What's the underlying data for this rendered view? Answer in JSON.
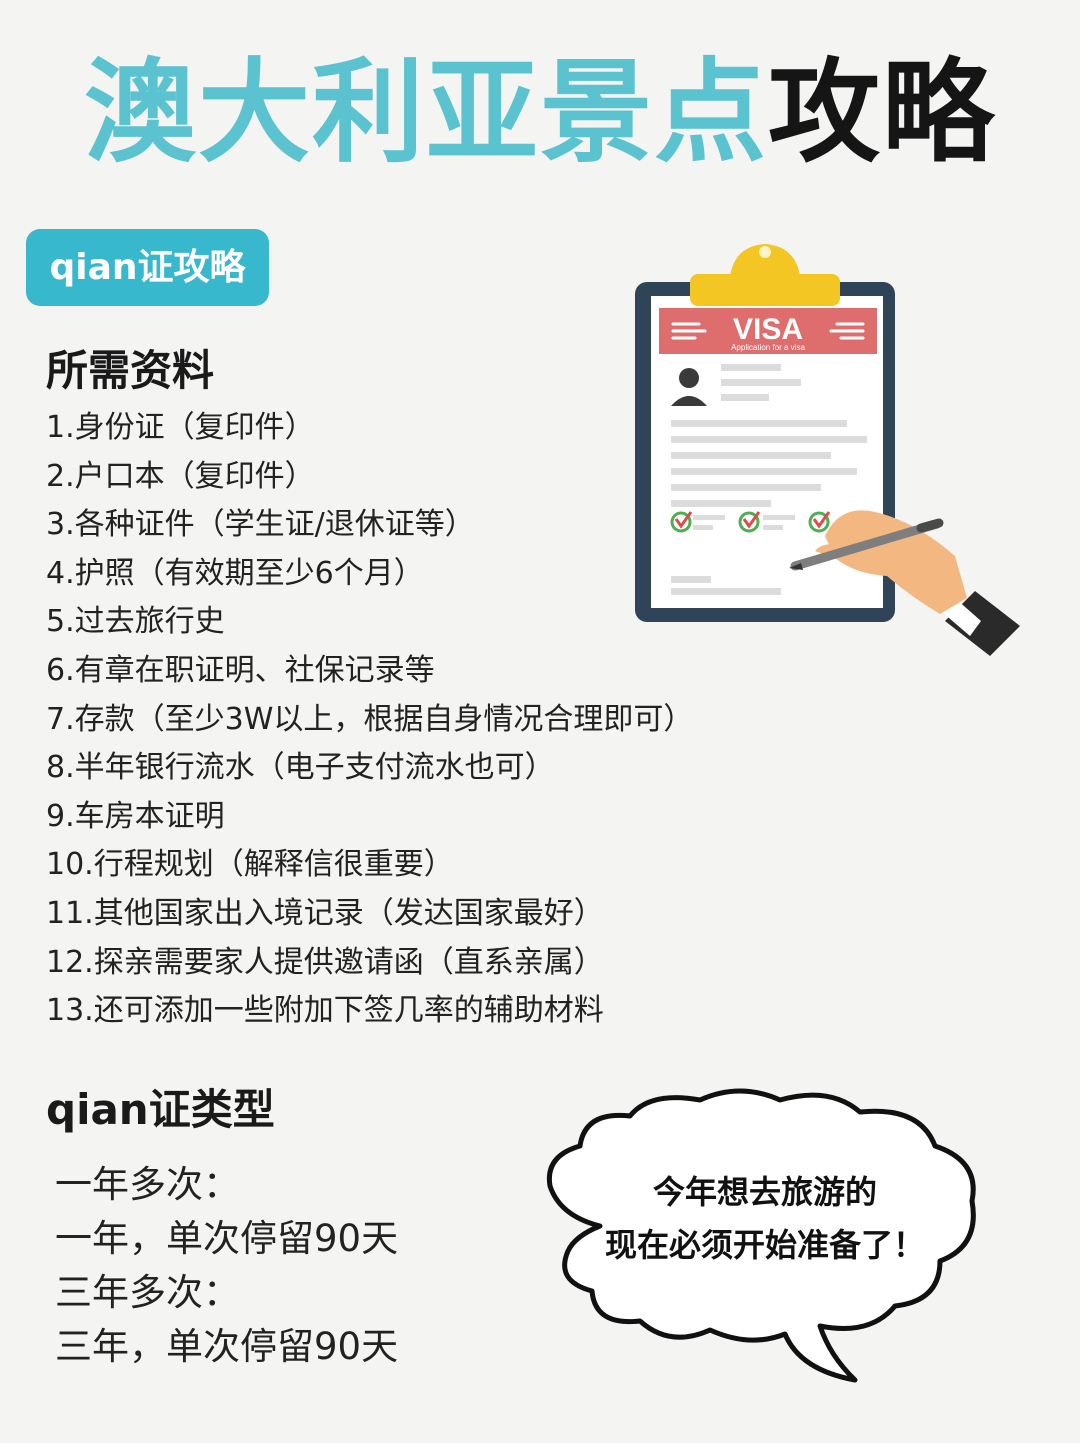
{
  "header": {
    "title_part1": "澳大利亚景点",
    "title_part2": "攻略"
  },
  "tag_label": "qian证攻略",
  "materials": {
    "heading": "所需资料",
    "items": [
      "1.身份证（复印件）",
      "2.户口本（复印件）",
      "3.各种证件（学生证/退休证等）",
      "4.护照（有效期至少6个月）",
      "5.过去旅行史",
      "6.有章在职证明、社保记录等",
      "7.存款（至少3W以上，根据自身情况合理即可）",
      "8.半年银行流水（电子支付流水也可）",
      "9.车房本证明",
      "10.行程规划（解释信很重要）",
      "11.其他国家出入境记录（发达国家最好）",
      "12.探亲需要家人提供邀请函（直系亲属）",
      "13.还可添加一些附加下签几率的辅助材料"
    ]
  },
  "visa_types": {
    "heading": "qian证类型",
    "lines": [
      "一年多次：",
      "一年，单次停留90天",
      "三年多次：",
      "三年，单次停留90天"
    ]
  },
  "clipboard": {
    "form_title": "VISA",
    "form_subtitle": "Application for a visa",
    "icons": [
      "clipboard-icon",
      "user-photo-icon",
      "check-icon",
      "pen-icon",
      "hand-icon"
    ]
  },
  "speech_bubble": {
    "line1": "今年想去旅游的",
    "line2": "现在必须开始准备了！"
  },
  "colors": {
    "accent_teal": "#37b8cc",
    "title_teal": "#5bc3d0",
    "visa_red": "#de6d6e",
    "clip_yellow": "#f3c623",
    "board_navy": "#2f4456"
  }
}
